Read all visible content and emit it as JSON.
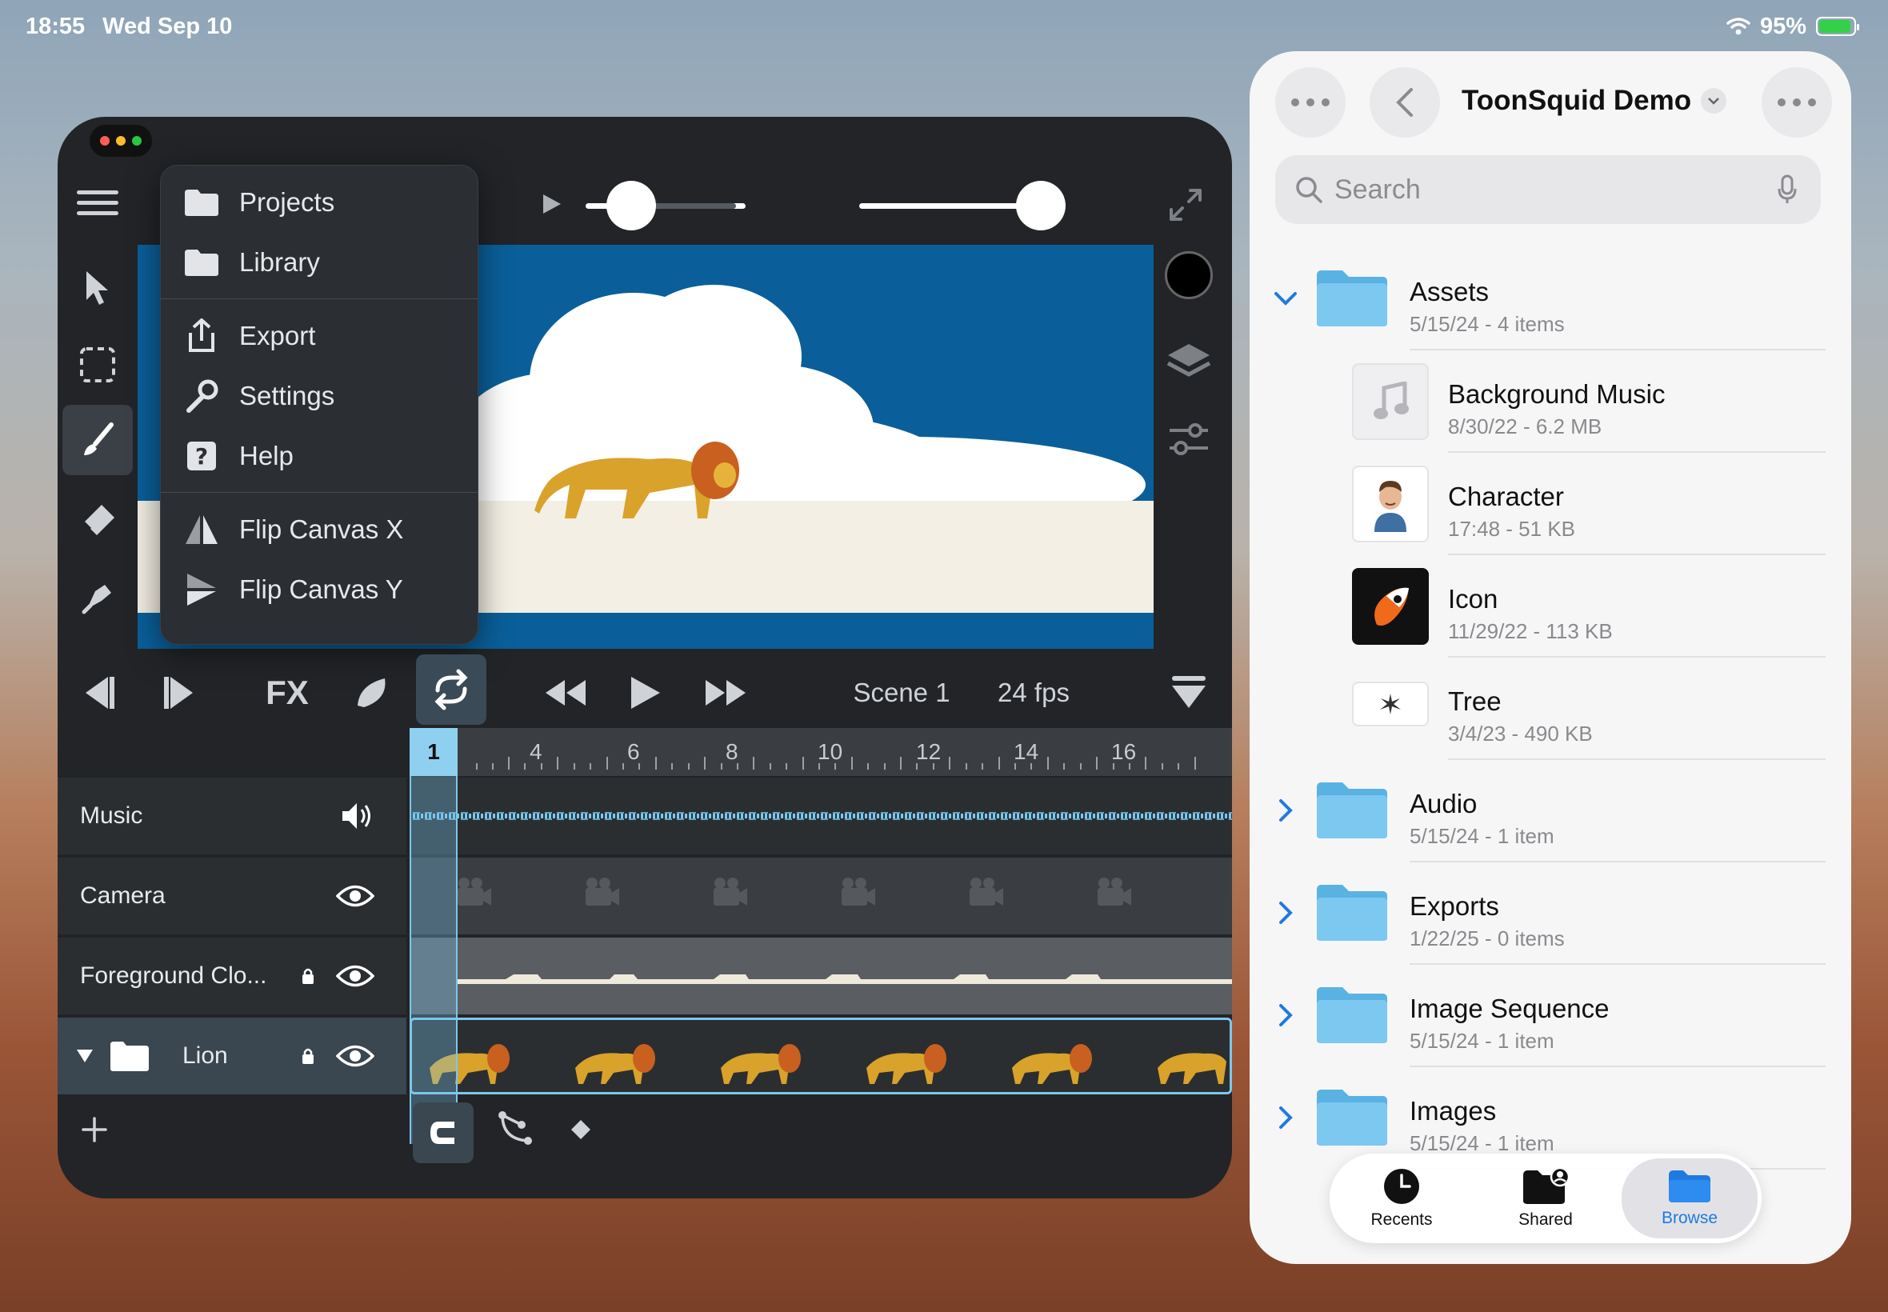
{
  "status_bar": {
    "time": "18:55",
    "date": "Wed Sep 10",
    "battery": "95%"
  },
  "editor": {
    "menu": [
      {
        "label": "Projects",
        "icon": "folder-icon"
      },
      {
        "label": "Library",
        "icon": "folder-icon"
      },
      {
        "label": "Export",
        "icon": "share-icon"
      },
      {
        "label": "Settings",
        "icon": "wrench-icon"
      },
      {
        "label": "Help",
        "icon": "help-icon"
      },
      {
        "label": "Flip Canvas X",
        "icon": "flip-x-icon"
      },
      {
        "label": "Flip Canvas Y",
        "icon": "flip-y-icon"
      }
    ],
    "fx_label": "FX",
    "scene": "Scene 1",
    "fps": "24 fps",
    "current_frame": "1",
    "ruler_ticks": [
      "4",
      "6",
      "8",
      "10",
      "12",
      "14",
      "16"
    ],
    "layers": [
      {
        "name": "Music"
      },
      {
        "name": "Camera"
      },
      {
        "name": "Foreground Clo..."
      },
      {
        "name": "Lion"
      }
    ]
  },
  "files": {
    "title": "ToonSquid Demo",
    "search_placeholder": "Search",
    "items": [
      {
        "name": "Assets",
        "meta": "5/15/24 - 4 items"
      },
      {
        "name": "Background Music",
        "meta": "8/30/22 - 6.2 MB"
      },
      {
        "name": "Character",
        "meta": "17:48 - 51 KB"
      },
      {
        "name": "Icon",
        "meta": "11/29/22 - 113 KB"
      },
      {
        "name": "Tree",
        "meta": "3/4/23 - 490 KB"
      },
      {
        "name": "Audio",
        "meta": "5/15/24 - 1 item"
      },
      {
        "name": "Exports",
        "meta": "1/22/25 - 0 items"
      },
      {
        "name": "Image Sequence",
        "meta": "5/15/24 - 1 item"
      },
      {
        "name": "Images",
        "meta": "5/15/24 - 1 item"
      }
    ],
    "tabs": [
      {
        "label": "Recents"
      },
      {
        "label": "Shared"
      },
      {
        "label": "Browse"
      }
    ]
  }
}
